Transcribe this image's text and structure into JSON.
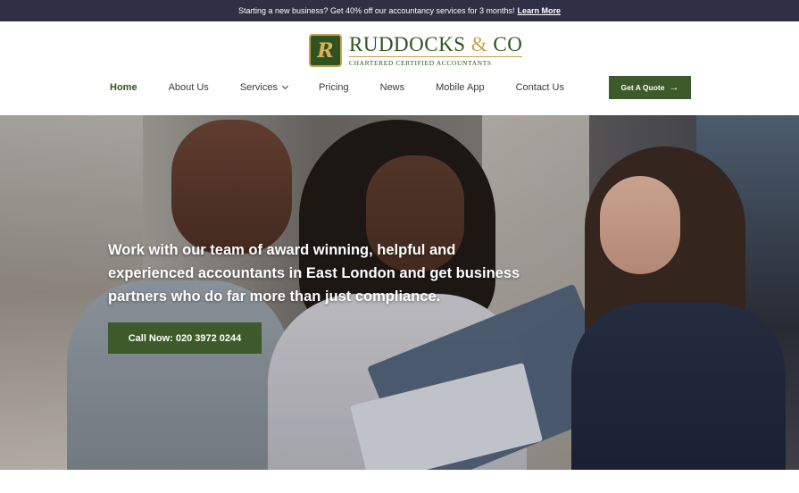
{
  "announcement": {
    "text": "Starting a new business? Get 40% off our accountancy services for 3 months!",
    "link": "Learn More"
  },
  "logo": {
    "mark": "R",
    "name_part1": "RUDDOCKS",
    "name_amp": "&",
    "name_part2": "CO",
    "tagline": "CHARTERED CERTIFIED ACCOUNTANTS"
  },
  "nav": {
    "items": [
      {
        "label": "Home",
        "active": true
      },
      {
        "label": "About Us"
      },
      {
        "label": "Services",
        "dropdown": true
      },
      {
        "label": "Pricing"
      },
      {
        "label": "News"
      },
      {
        "label": "Mobile App"
      },
      {
        "label": "Contact Us"
      }
    ],
    "cta_label": "Get A Quote",
    "cta_icon": "arrow-right-icon"
  },
  "hero": {
    "headline": "Work with our team of award winning, helpful and experienced accountants in East London and get business partners who do far more than just compliance.",
    "button_label": "Call Now: 020 3972 0244"
  },
  "colors": {
    "brand_green": "#3d5b2a",
    "topbar": "#2f3043",
    "gold": "#c8a24a"
  }
}
